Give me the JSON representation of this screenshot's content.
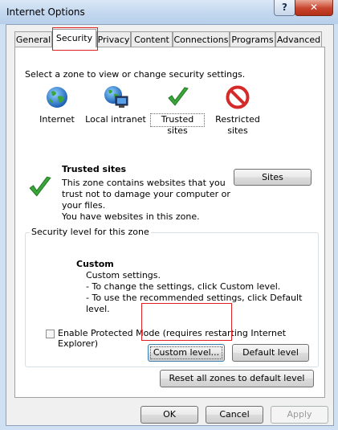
{
  "window": {
    "title": "Internet Options"
  },
  "title_buttons": {
    "help": "?",
    "close": "✕"
  },
  "tabs": [
    {
      "label": "General"
    },
    {
      "label": "Security"
    },
    {
      "label": "Privacy"
    },
    {
      "label": "Content"
    },
    {
      "label": "Connections"
    },
    {
      "label": "Programs"
    },
    {
      "label": "Advanced"
    }
  ],
  "security": {
    "instruction": "Select a zone to view or change security settings.",
    "zones": [
      {
        "label": "Internet",
        "icon": "globe-icon"
      },
      {
        "label": "Local intranet",
        "icon": "intranet-icon"
      },
      {
        "label": "Trusted sites",
        "icon": "checkmark-icon"
      },
      {
        "label": "Restricted",
        "label2": "sites",
        "icon": "restricted-icon"
      }
    ],
    "zone_info": {
      "title": "Trusted sites",
      "lines": [
        "This zone contains websites that you",
        "trust not to damage your computer or",
        "your files.",
        "You have websites in this zone."
      ],
      "sites_button": "Sites"
    },
    "level_group": {
      "title": "Security level for this zone",
      "level_name": "Custom",
      "lines": [
        "Custom settings.",
        "- To change the settings, click Custom level.",
        "- To use the recommended settings, click Default level."
      ]
    },
    "protected_mode": {
      "label": "Enable Protected Mode (requires restarting Internet Explorer)",
      "checked": false
    },
    "custom_level_button": "Custom level...",
    "default_level_button": "Default level",
    "reset_all_button": "Reset all zones to default level"
  },
  "footer": {
    "ok": "OK",
    "cancel": "Cancel",
    "apply": "Apply"
  },
  "colors": {
    "highlight": "#e02020",
    "titlebar": "#c4d8ef",
    "close": "#c7432c",
    "check_green": "#3aa63a",
    "restricted_red": "#d42a2a"
  }
}
